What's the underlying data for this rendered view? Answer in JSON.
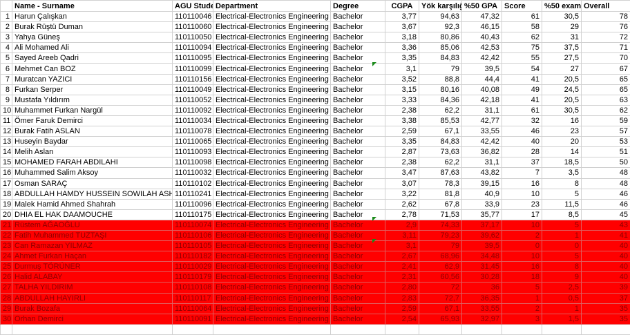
{
  "headers": [
    "",
    "Name - Surname",
    "AGU Student",
    "Department",
    "Degree",
    "CGPA",
    "Yök karşılığı",
    "%50 GPA",
    "Score",
    "%50 exam",
    "Overall"
  ],
  "rows": [
    [
      "1",
      "Harun Çalışkan",
      "110110046",
      "Electrical-Electronics Engineering",
      "Bachelor",
      "3,77",
      "94,63",
      "47,32",
      "61",
      "30,5",
      "78"
    ],
    [
      "2",
      "Burak Rüştü Duman",
      "110110060",
      "Electrical-Electronics Engineering",
      "Bachelor",
      "3,67",
      "92,3",
      "46,15",
      "58",
      "29",
      "76"
    ],
    [
      "3",
      "Yahya Güneş",
      "110110050",
      "Electrical-Electronics Engineering",
      "Bachelor",
      "3,18",
      "80,86",
      "40,43",
      "62",
      "31",
      "72"
    ],
    [
      "4",
      "Ali Mohamed Ali",
      "110110094",
      "Electrical-Electronics Engineering",
      "Bachelor",
      "3,36",
      "85,06",
      "42,53",
      "75",
      "37,5",
      "71"
    ],
    [
      "5",
      "Sayed Areeb Qadri",
      "110110095",
      "Electrical-Electronics Engineering",
      "Bachelor",
      "3,35",
      "84,83",
      "42,42",
      "55",
      "27,5",
      "70"
    ],
    [
      "6",
      "Mehmet Can BOZ",
      "110110099",
      "Electrical-Electronics Engineering",
      "Bachelor",
      "3,1",
      "79",
      "39,5",
      "54",
      "27",
      "67"
    ],
    [
      "7",
      "Muratcan YAZICI",
      "110110156",
      "Electrical-Electronics Engineering",
      "Bachelor",
      "3,52",
      "88,8",
      "44,4",
      "41",
      "20,5",
      "65"
    ],
    [
      "8",
      "Furkan Serper",
      "110110049",
      "Electrical-Electronics Engineering",
      "Bachelor",
      "3,15",
      "80,16",
      "40,08",
      "49",
      "24,5",
      "65"
    ],
    [
      "9",
      "Mustafa Yıldırım",
      "110110052",
      "Electrical-Electronics Engineering",
      "Bachelor",
      "3,33",
      "84,36",
      "42,18",
      "41",
      "20,5",
      "63"
    ],
    [
      "10",
      "Muhammet Furkan Nargül",
      "110110092",
      "Electrical-Electronics Engineering",
      "Bachelor",
      "2,38",
      "62,2",
      "31,1",
      "61",
      "30,5",
      "62"
    ],
    [
      "11",
      "Ömer Faruk Demirci",
      "110110034",
      "Electrical-Electronics Engineering",
      "Bachelor",
      "3,38",
      "85,53",
      "42,77",
      "32",
      "16",
      "59"
    ],
    [
      "12",
      "Burak Fatih ASLAN",
      "110110078",
      "Electrical-Electronics Engineering",
      "Bachelor",
      "2,59",
      "67,1",
      "33,55",
      "46",
      "23",
      "57"
    ],
    [
      "13",
      "Huseyin Baydar",
      "110110065",
      "Electrical-Electronics Engineering",
      "Bachelor",
      "3,35",
      "84,83",
      "42,42",
      "40",
      "20",
      "53"
    ],
    [
      "14",
      "Melih Aslan",
      "110110093",
      "Electrical-Electronics Engineering",
      "Bachelor",
      "2,87",
      "73,63",
      "36,82",
      "28",
      "14",
      "51"
    ],
    [
      "15",
      "MOHAMED FARAH ABDILAHI",
      "110110098",
      "Electrical-Electronics Engineering",
      "Bachelor",
      "2,38",
      "62,2",
      "31,1",
      "37",
      "18,5",
      "50"
    ],
    [
      "16",
      "Muhammed Salim Aksoy",
      "110110032",
      "Electrical-Electronics Engineering",
      "Bachelor",
      "3,47",
      "87,63",
      "43,82",
      "7",
      "3,5",
      "48"
    ],
    [
      "17",
      "Osman SARAÇ",
      "110110102",
      "Electrical-Electronics Engineering",
      "Bachelor",
      "3,07",
      "78,3",
      "39,15",
      "16",
      "8",
      "48"
    ],
    [
      "18",
      "ABDULLAH HAMDY HUSSEIN SOWILAH ASHOUR",
      "110110241",
      "Electrical-Electronics Engineering",
      "Bachelor",
      "3,22",
      "81,8",
      "40,9",
      "10",
      "5",
      "46"
    ],
    [
      "19",
      "Malek Hamid Ahmed Shahrah",
      "110110096",
      "Electrical-Electronics Engineering",
      "Bachelor",
      "2,62",
      "67,8",
      "33,9",
      "23",
      "11,5",
      "46"
    ],
    [
      "20",
      "DHIA EL HAK DAAMOUCHE",
      "110110175",
      "Electrical-Electronics Engineering",
      "Bachelor",
      "2,78",
      "71,53",
      "35,77",
      "17",
      "8,5",
      "45"
    ],
    [
      "21",
      "Rüstem AĞAOĞLU",
      "110110074",
      "Electrical-Electronics Engineering",
      "Bachelor",
      "2,9",
      "74,33",
      "37,17",
      "10",
      "5",
      "43"
    ],
    [
      "22",
      "Fatih Muhammed TUZTAŞI",
      "110110106",
      "Electrical-Electronics Engineering",
      "Bachelor",
      "3,11",
      "79,23",
      "39,62",
      "2",
      "1",
      "41"
    ],
    [
      "23",
      "Can Ramazan YILMAZ",
      "110110105",
      "Electrical-Electronics Engineering",
      "Bachelor",
      "3,1",
      "79",
      "39,5",
      "0",
      "0",
      "40"
    ],
    [
      "24",
      "Ahmet Furkan Haçan",
      "110110182",
      "Electrical-Electronics Engineering",
      "Bachelor",
      "2,67",
      "68,96",
      "34,48",
      "10",
      "5",
      "40"
    ],
    [
      "25",
      "Durmuş TÖRÜNER",
      "110110029",
      "Electrical-Electronics Engineering",
      "Bachelor",
      "2,41",
      "62,9",
      "31,45",
      "16",
      "8",
      "40"
    ],
    [
      "26",
      "Halid ALABAY",
      "110110179",
      "Electrical-Electronics Engineering",
      "Bachelor",
      "2,31",
      "60,56",
      "30,28",
      "18",
      "9",
      "40"
    ],
    [
      "27",
      "TALHA YILDIRIM",
      "110110108",
      "Electrical-Electronics Engineering",
      "Bachelor",
      "2,80",
      "72",
      "36",
      "5",
      "2,5",
      "39"
    ],
    [
      "28",
      "ABDULLAH HAYIRLI",
      "110110117",
      "Electrical-Electronics Engineering",
      "Bachelor",
      "2,83",
      "72,7",
      "36,35",
      "1",
      "0,5",
      "37"
    ],
    [
      "29",
      "Burak Bozafa",
      "110110064",
      "Electrical-Electronics Engineering",
      "Bachelor",
      "2,59",
      "67,1",
      "33,55",
      "2",
      "1",
      "35"
    ],
    [
      "30",
      "Orhan Demirci",
      "110110091",
      "Electrical-Electronics Engineering",
      "Bachelor",
      "2,54",
      "65,93",
      "32,97",
      "3",
      "1,5",
      "35"
    ]
  ]
}
